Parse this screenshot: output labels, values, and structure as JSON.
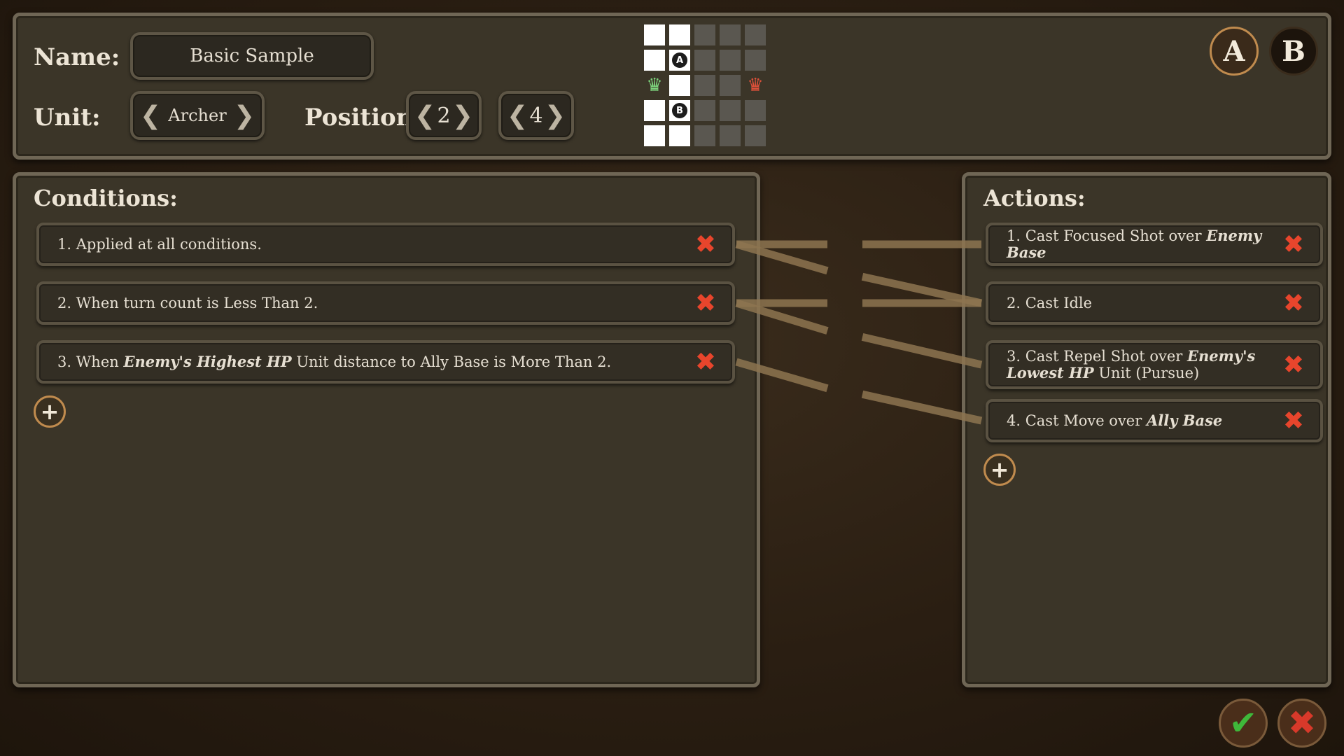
{
  "header": {
    "name_label": "Name:",
    "name_value": "Basic Sample",
    "unit_label": "Unit:",
    "unit_value": "Archer",
    "position_label": "Position:",
    "position_x": "2",
    "position_y": "4",
    "prev_arrow": "❮",
    "next_arrow": "❯",
    "team_buttons": {
      "a_label": "A",
      "b_label": "B"
    }
  },
  "position_grid": {
    "columns": 5,
    "rows": 5,
    "cells": [
      [
        "white",
        "white",
        "gray",
        "gray",
        "gray"
      ],
      [
        "white",
        "marker-A",
        "gray",
        "gray",
        "gray"
      ],
      [
        "crown-green",
        "white",
        "gray",
        "gray",
        "crown-red"
      ],
      [
        "white",
        "marker-B",
        "gray",
        "gray",
        "gray"
      ],
      [
        "white",
        "white",
        "gray",
        "gray",
        "gray"
      ]
    ],
    "marker_a": "A",
    "marker_b": "B",
    "crown_glyph": "♛",
    "ally_crown_color": "#7ed67e",
    "enemy_crown_color": "#e0513a"
  },
  "conditions": {
    "title": "Conditions:",
    "items": [
      {
        "text": "1. Applied at all conditions."
      },
      {
        "text": "2. When turn count is Less Than 2."
      },
      {
        "pre": "3. When ",
        "em": "Enemy's Highest HP",
        "post": " Unit distance to Ally Base is More Than 2."
      }
    ],
    "add_symbol": "+"
  },
  "actions": {
    "title": "Actions:",
    "items": [
      {
        "pre": "1. Cast Focused Shot over ",
        "em": "Enemy Base",
        "post": ""
      },
      {
        "pre": "2. Cast Idle",
        "em": "",
        "post": ""
      },
      {
        "pre": "3. Cast Repel Shot over ",
        "em": "Enemy's Lowest HP",
        "post": " Unit (Pursue)"
      },
      {
        "pre": "4. Cast Move over ",
        "em": "Ally Base",
        "post": ""
      }
    ],
    "add_symbol": "+"
  },
  "connections": [
    [
      0,
      0
    ],
    [
      0,
      1
    ],
    [
      1,
      1
    ],
    [
      1,
      2
    ],
    [
      2,
      3
    ]
  ],
  "remove_symbol": "✖",
  "footer": {
    "confirm_symbol": "✔",
    "cancel_symbol": "✖"
  },
  "colors": {
    "remove_red": "#e8452c",
    "confirm_green": "#3fb83a",
    "cancel_red": "#d8392a",
    "accent_orange": "#c08b4e",
    "link_tan": "#8d7450"
  }
}
